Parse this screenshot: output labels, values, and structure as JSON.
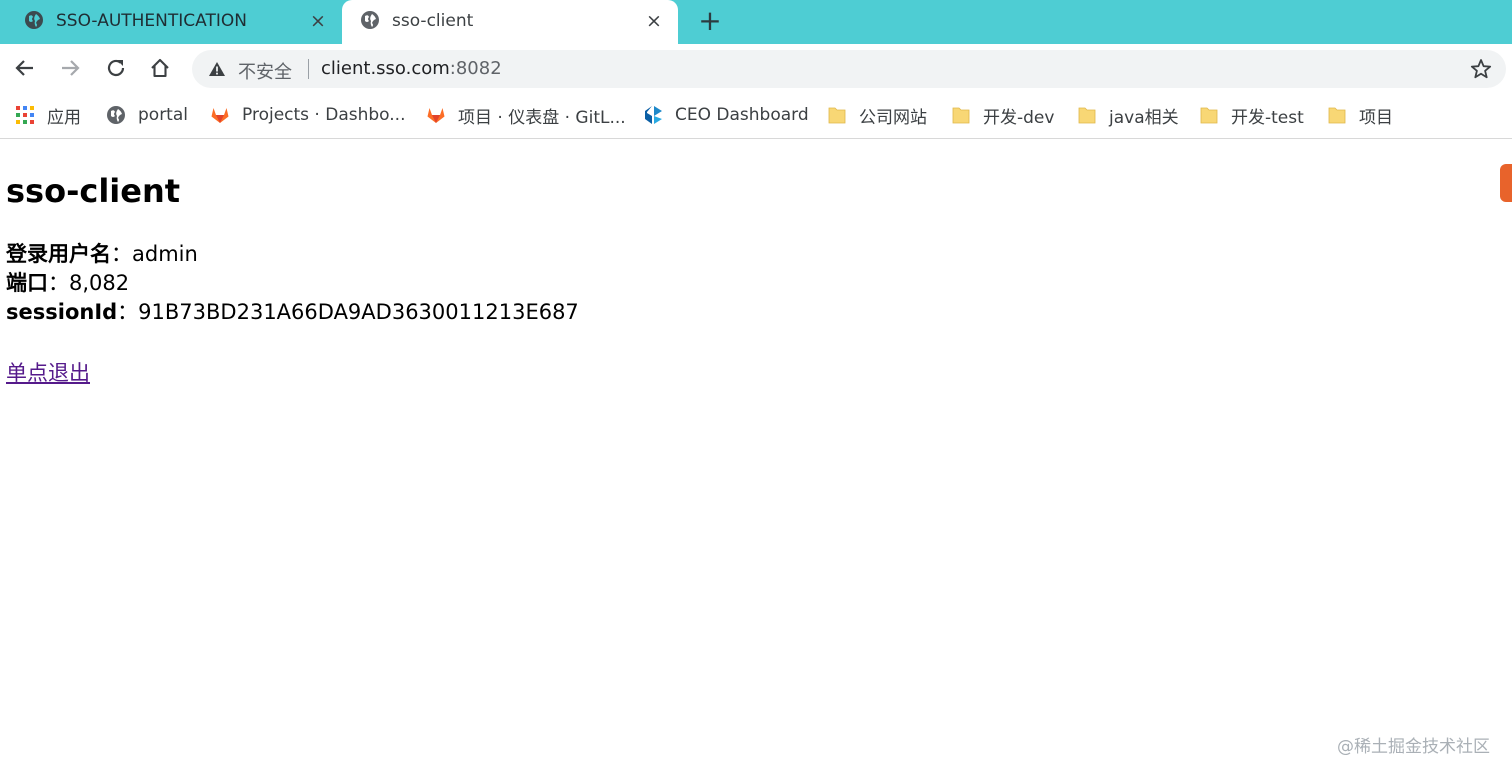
{
  "tabs": [
    {
      "title": "SSO-AUTHENTICATION",
      "icon": "globe-icon",
      "close": "×"
    },
    {
      "title": "sso-client",
      "icon": "globe-icon",
      "close": "×"
    }
  ],
  "new_tab": "+",
  "address_bar": {
    "security_label": "不安全",
    "host": "client.sso.com",
    "port": ":8082"
  },
  "bookmarks": [
    {
      "label": "应用",
      "icon": "apps-grid-icon"
    },
    {
      "label": "portal",
      "icon": "globe-icon"
    },
    {
      "label": "Projects · Dashbo...",
      "icon": "gitlab-icon"
    },
    {
      "label": "项目 · 仪表盘 · GitL...",
      "icon": "gitlab-icon"
    },
    {
      "label": "CEO Dashboard",
      "icon": "dashboard-logo-icon"
    },
    {
      "label": "公司网站",
      "icon": "folder-icon"
    },
    {
      "label": "开发-dev",
      "icon": "folder-icon"
    },
    {
      "label": "java相关",
      "icon": "folder-icon"
    },
    {
      "label": "开发-test",
      "icon": "folder-icon"
    },
    {
      "label": "项目",
      "icon": "folder-icon"
    }
  ],
  "page": {
    "title": "sso-client",
    "username_label": "登录用户名",
    "username_sep": "：",
    "username": "admin",
    "port_label": "端口",
    "port_sep": "：",
    "port": "8,082",
    "session_label": "sessionId",
    "session_sep": "：",
    "session_id": "91B73BD231A66DA9AD3630011213E687",
    "logout_link": "单点退出"
  },
  "watermark": "@稀土掘金技术社区",
  "colors": {
    "tabstrip": "#4ecdd3",
    "link_visited": "#551a8b",
    "folder": "#f8d775",
    "gitlab": "#e2432a"
  }
}
